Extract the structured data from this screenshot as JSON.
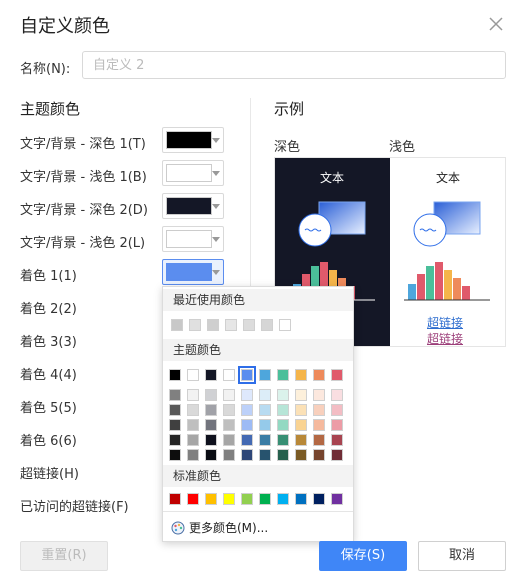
{
  "dialog": {
    "title": "自定义颜色",
    "name_label": "名称(N):",
    "name_placeholder": "自定义 2",
    "theme_section": "主题颜色",
    "example_section": "示例",
    "rows": [
      {
        "label": "文字/背景 - 深色 1(T)",
        "color": "#000000"
      },
      {
        "label": "文字/背景 - 浅色 1(B)",
        "color": "#ffffff"
      },
      {
        "label": "文字/背景 - 深色 2(D)",
        "color": "#141726"
      },
      {
        "label": "文字/背景 - 浅色 2(L)",
        "color": "#ffffff"
      },
      {
        "label": "着色 1(1)",
        "color": "#5b8def"
      },
      {
        "label": "着色 2(2)"
      },
      {
        "label": "着色 3(3)"
      },
      {
        "label": "着色 4(4)"
      },
      {
        "label": "着色 5(5)"
      },
      {
        "label": "着色 6(6)"
      },
      {
        "label": "超链接(H)"
      },
      {
        "label": "已访问的超链接(F)"
      }
    ],
    "preview": {
      "dark_label": "深色",
      "light_label": "浅色",
      "text": "文本",
      "link": "超链接",
      "visited_link": "超链接"
    },
    "buttons": {
      "reset": "重置(R)",
      "save": "保存(S)",
      "cancel": "取消"
    }
  },
  "color_popup": {
    "recent_header": "最近使用颜色",
    "recent_colors": [
      "#c8c8c8",
      "#e0e0e0",
      "#cfcfcf",
      "#e6e6e6",
      "#dcdcdc",
      "#d6d6d6",
      "#ffffff"
    ],
    "theme_header": "主题颜色",
    "theme_colors": [
      "#000000",
      "#ffffff",
      "#141726",
      "#ffffff",
      "#5b8def",
      "#4ea6dc",
      "#4bbf9a",
      "#f5b54a",
      "#ee8a5b",
      "#e05a6b"
    ],
    "standard_header": "标准颜色",
    "standard_colors": [
      "#c00000",
      "#ff0000",
      "#ffc000",
      "#ffff00",
      "#92d050",
      "#00b050",
      "#00b0f0",
      "#0070c0",
      "#002060",
      "#7030a0"
    ],
    "more_label": "更多颜色(M)..."
  },
  "colors": {
    "accent": "#3f86f7",
    "link": "#2f6ecf",
    "visited_link": "#9c3f7a"
  }
}
